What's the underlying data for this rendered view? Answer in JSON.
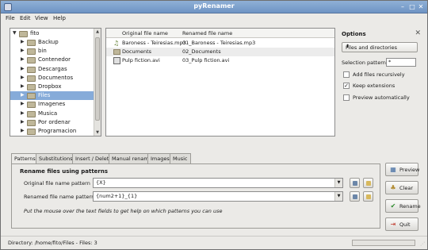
{
  "window": {
    "title": "pyRenamer"
  },
  "menubar": [
    "File",
    "Edit",
    "View",
    "Help"
  ],
  "tree": {
    "root": "fito",
    "items": [
      {
        "label": "Backup",
        "selected": false
      },
      {
        "label": "bin",
        "selected": false
      },
      {
        "label": "Contenedor",
        "selected": false
      },
      {
        "label": "Descargas",
        "selected": false
      },
      {
        "label": "Documentos",
        "selected": false
      },
      {
        "label": "Dropbox",
        "selected": false
      },
      {
        "label": "Files",
        "selected": true
      },
      {
        "label": "Imagenes",
        "selected": false
      },
      {
        "label": "Musica",
        "selected": false
      },
      {
        "label": "Por ordenar",
        "selected": false
      },
      {
        "label": "Programacion",
        "selected": false
      }
    ]
  },
  "files": {
    "columns": [
      "Original file name",
      "Renamed file name"
    ],
    "rows": [
      {
        "icon": "music-file-icon",
        "original": "Baroness - Teiresias.mp3",
        "renamed": "01_Baroness - Teiresias.mp3"
      },
      {
        "icon": "folder-icon",
        "original": "Documents",
        "renamed": "02_Documents"
      },
      {
        "icon": "video-file-icon",
        "original": "Pulp fiction.avi",
        "renamed": "03_Pulp fiction.avi"
      }
    ]
  },
  "options": {
    "title": "Options",
    "mode": "Files and directories",
    "selection_pattern_label": "Selection pattern",
    "selection_pattern_value": "*",
    "add_recursive": {
      "label": "Add files recursively",
      "checked": false
    },
    "keep_extensions": {
      "label": "Keep extensions",
      "checked": true
    },
    "preview_auto": {
      "label": "Preview automatically",
      "checked": false
    }
  },
  "tabs": [
    "Patterns",
    "Substitutions",
    "Insert / Delete",
    "Manual rename",
    "Images",
    "Music"
  ],
  "patterns": {
    "title": "Rename files using patterns",
    "original_label": "Original file name pattern",
    "original_value": "{X}",
    "renamed_label": "Renamed file name pattern",
    "renamed_value": "{num2+1}_{1}",
    "hint": "Put the mouse over the text fields to get help on which patterns you can use"
  },
  "actions": {
    "preview": "Preview",
    "clear": "Clear",
    "rename": "Rename",
    "quit": "Quit"
  },
  "statusbar": {
    "text": "Directory: /home/fito/Files - Files: 3"
  },
  "colors": {
    "selection": "#86abd9",
    "titlebar": "#7a9dcb"
  }
}
